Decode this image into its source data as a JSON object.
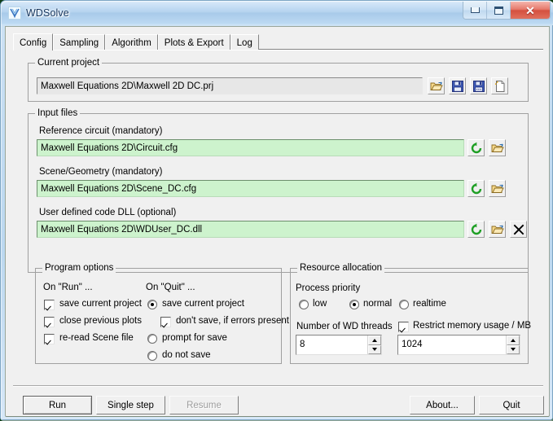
{
  "window": {
    "title": "WDSolve",
    "app_icon": "wdsolve-logo-icon",
    "minimize_label": "Minimize",
    "maximize_label": "Maximize",
    "close_label": "Close",
    "close_glyph": "✕"
  },
  "tabs": [
    {
      "label": "Config",
      "active": true
    },
    {
      "label": "Sampling",
      "active": false
    },
    {
      "label": "Algorithm",
      "active": false
    },
    {
      "label": "Plots & Export",
      "active": false
    },
    {
      "label": "Log",
      "active": false
    }
  ],
  "current_project": {
    "group_title": "Current project",
    "path": "Maxwell Equations 2D\\Maxwell 2D DC.prj",
    "buttons": [
      {
        "name": "open-project-button",
        "icon": "open-folder-icon"
      },
      {
        "name": "save-project-button",
        "icon": "save-floppy-icon"
      },
      {
        "name": "save-project-as-button",
        "icon": "save-as-floppy-icon"
      },
      {
        "name": "new-project-button",
        "icon": "new-file-icon"
      }
    ]
  },
  "input_files": {
    "group_title": "Input files",
    "rows": [
      {
        "label": "Reference circuit (mandatory)",
        "value": "Maxwell Equations 2D\\Circuit.cfg",
        "reload_icon": "reload-refresh-icon",
        "browse_icon": "open-folder-icon",
        "has_clear": false
      },
      {
        "label": "Scene/Geometry (mandatory)",
        "value": "Maxwell Equations 2D\\Scene_DC.cfg",
        "reload_icon": "reload-refresh-icon",
        "browse_icon": "open-folder-icon",
        "has_clear": false
      },
      {
        "label": "User defined code DLL (optional)",
        "value": "Maxwell Equations 2D\\WDUser_DC.dll",
        "reload_icon": "reload-refresh-icon",
        "browse_icon": "open-folder-icon",
        "has_clear": true,
        "clear_icon": "close-x-icon"
      }
    ]
  },
  "program_options": {
    "group_title": "Program options",
    "on_run_title": "On \"Run\" ...",
    "on_quit_title": "On \"Quit\" ...",
    "on_run": [
      {
        "label": "save current project",
        "checked": true
      },
      {
        "label": "close previous plots",
        "checked": true
      },
      {
        "label": "re-read Scene file",
        "checked": true
      }
    ],
    "on_quit": [
      {
        "label": "save current project",
        "selected": true
      },
      {
        "label": "prompt for save",
        "selected": false
      },
      {
        "label": "do not save",
        "selected": false
      }
    ],
    "on_quit_suboption": {
      "label": "don't save, if errors present",
      "checked": true
    }
  },
  "resource_allocation": {
    "group_title": "Resource allocation",
    "priority_label": "Process priority",
    "priority_options": [
      {
        "label": "low",
        "selected": false
      },
      {
        "label": "normal",
        "selected": true
      },
      {
        "label": "realtime",
        "selected": false
      }
    ],
    "threads_label": "Number of WD threads",
    "threads_value": "8",
    "memory_label": "Restrict memory usage / MB",
    "memory_checked": true,
    "memory_value": "1024"
  },
  "footer": {
    "run": "Run",
    "single_step": "Single step",
    "resume": "Resume",
    "about": "About...",
    "quit": "Quit"
  },
  "colors": {
    "titlebar_blue": "#b5d3ef",
    "close_red": "#d4503f",
    "field_green": "#cdf3cd",
    "field_gray": "#e7e7e7",
    "dialog_face": "#f0f0f0",
    "reload_green": "#1f9f25",
    "folder_yellow": "#f5c944"
  }
}
